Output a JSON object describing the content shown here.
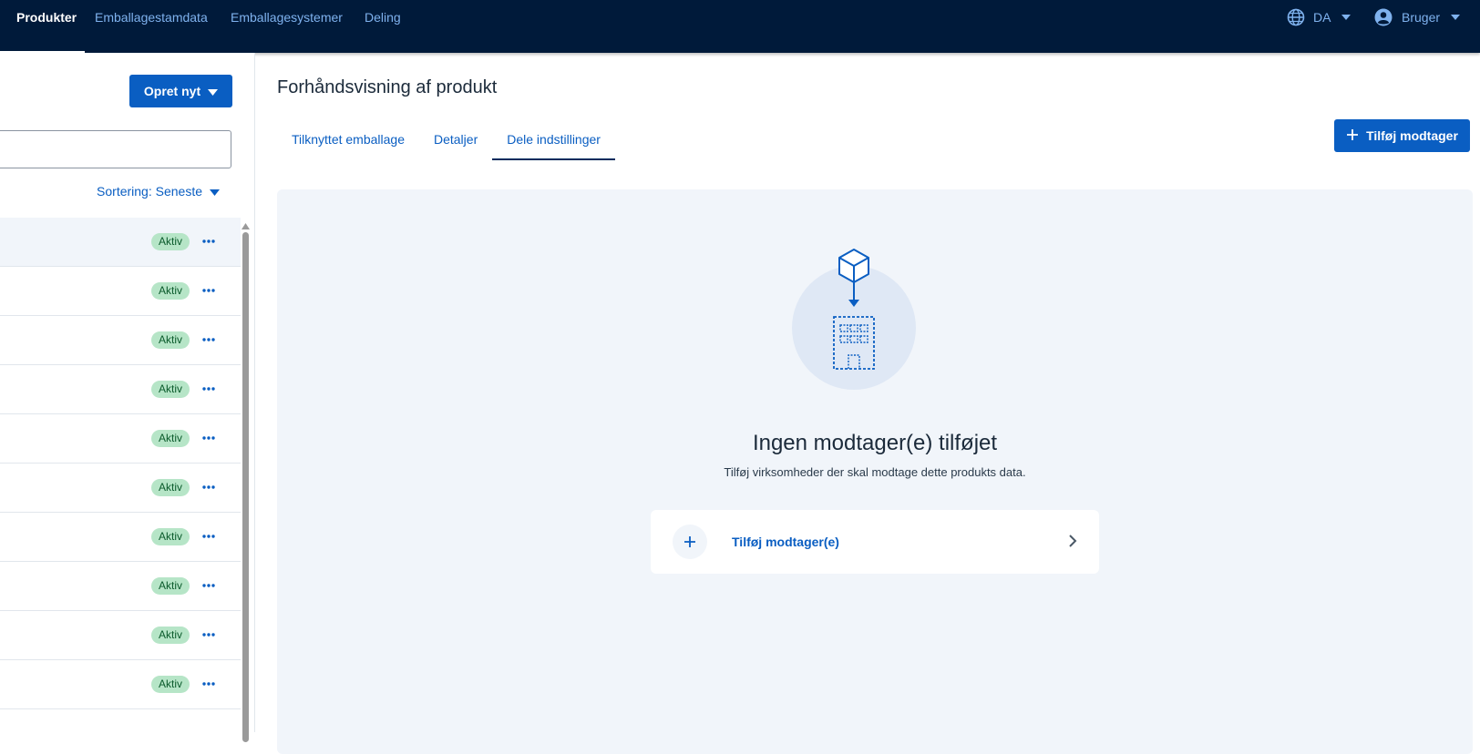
{
  "topnav": {
    "items": [
      {
        "label": "Produkter",
        "active": true
      },
      {
        "label": "Emballagestamdata",
        "active": false
      },
      {
        "label": "Emballagesystemer",
        "active": false
      },
      {
        "label": "Deling",
        "active": false
      }
    ],
    "language": "DA",
    "user": "Bruger"
  },
  "left": {
    "create_button": "Opret nyt",
    "search": {
      "value": "",
      "placeholder": ""
    },
    "sort_label": "Sortering: Seneste",
    "rows": [
      {
        "status": "Aktiv"
      },
      {
        "status": "Aktiv"
      },
      {
        "status": "Aktiv"
      },
      {
        "status": "Aktiv"
      },
      {
        "status": "Aktiv"
      },
      {
        "status": "Aktiv"
      },
      {
        "status": "Aktiv"
      },
      {
        "status": "Aktiv"
      },
      {
        "status": "Aktiv"
      },
      {
        "status": "Aktiv"
      }
    ]
  },
  "main": {
    "title": "Forhåndsvisning af produkt",
    "tabs": [
      {
        "label": "Tilknyttet emballage"
      },
      {
        "label": "Detaljer"
      },
      {
        "label": "Dele indstillinger"
      }
    ],
    "add_recipient_button": "Tilføj modtager",
    "empty": {
      "title": "Ingen modtager(e) tilføjet",
      "subtitle": "Tilføj virksomheder der skal modtage dette produkts data.",
      "action": "Tilføj modtager(e)"
    }
  },
  "colors": {
    "nav_bg": "#001a3a",
    "accent": "#0a5ec2",
    "badge_bg": "#b6e5c7",
    "badge_text": "#0a5a2b",
    "panel_bg": "#f1f5fa"
  }
}
